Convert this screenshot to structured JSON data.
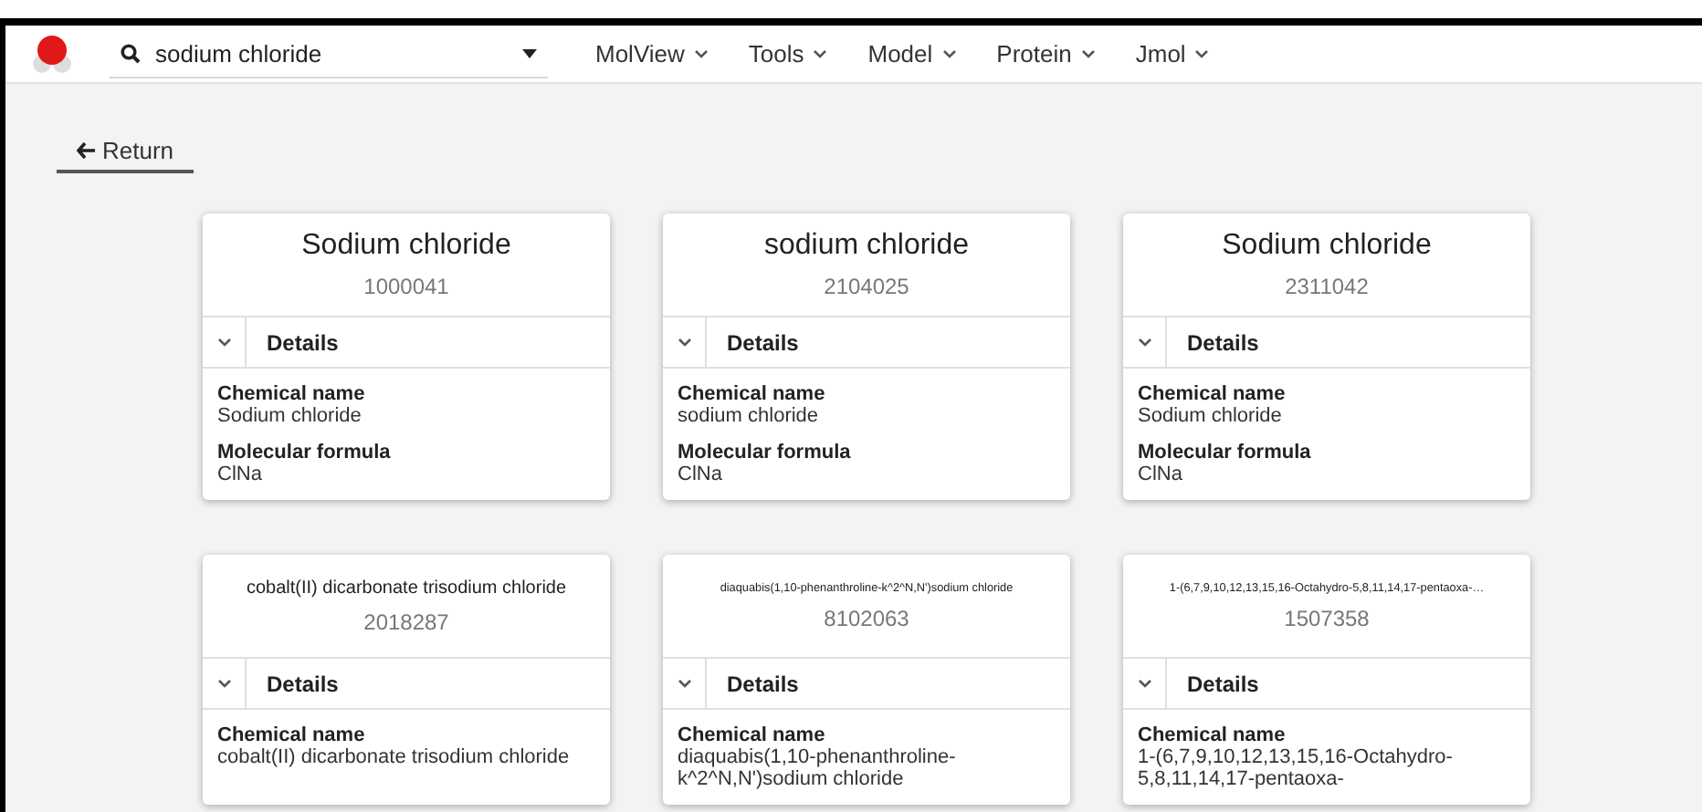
{
  "search": {
    "value": "sodium chloride"
  },
  "menus": [
    {
      "label": "MolView"
    },
    {
      "label": "Tools"
    },
    {
      "label": "Model"
    },
    {
      "label": "Protein"
    },
    {
      "label": "Jmol"
    }
  ],
  "return_button": {
    "label": "Return"
  },
  "results": [
    {
      "title": "Sodium chloride",
      "id": "1000041",
      "details_label": "Details",
      "expanded": true,
      "fields": [
        {
          "label": "Chemical name",
          "value": "Sodium chloride"
        },
        {
          "label": "Molecular formula",
          "value": "ClNa"
        }
      ]
    },
    {
      "title": "sodium chloride",
      "id": "2104025",
      "details_label": "Details",
      "expanded": true,
      "fields": [
        {
          "label": "Chemical name",
          "value": "sodium chloride"
        },
        {
          "label": "Molecular formula",
          "value": "ClNa"
        }
      ]
    },
    {
      "title": "Sodium chloride",
      "id": "2311042",
      "details_label": "Details",
      "expanded": true,
      "fields": [
        {
          "label": "Chemical name",
          "value": "Sodium chloride"
        },
        {
          "label": "Molecular formula",
          "value": "ClNa"
        }
      ]
    },
    {
      "title": "cobalt(II) dicarbonate trisodium chloride",
      "id": "2018287",
      "details_label": "Details",
      "expanded": true,
      "fields": [
        {
          "label": "Chemical name",
          "value": "cobalt(II) dicarbonate trisodium chloride"
        }
      ]
    },
    {
      "title": "diaquabis(1,10-phenanthroline-k^2^N,N')sodium chloride",
      "id": "8102063",
      "details_label": "Details",
      "expanded": true,
      "fields": [
        {
          "label": "Chemical name",
          "value": "diaquabis(1,10-phenanthroline-k^2^N,N')sodium chloride"
        }
      ]
    },
    {
      "title": "1-(6,7,9,10,12,13,15,16-Octahydro-5,8,11,14,17-pentaoxa-…",
      "id": "1507358",
      "details_label": "Details",
      "expanded": true,
      "fields": [
        {
          "label": "Chemical name",
          "value": "1-(6,7,9,10,12,13,15,16-Octahydro-5,8,11,14,17-pentaoxa-"
        }
      ]
    }
  ]
}
